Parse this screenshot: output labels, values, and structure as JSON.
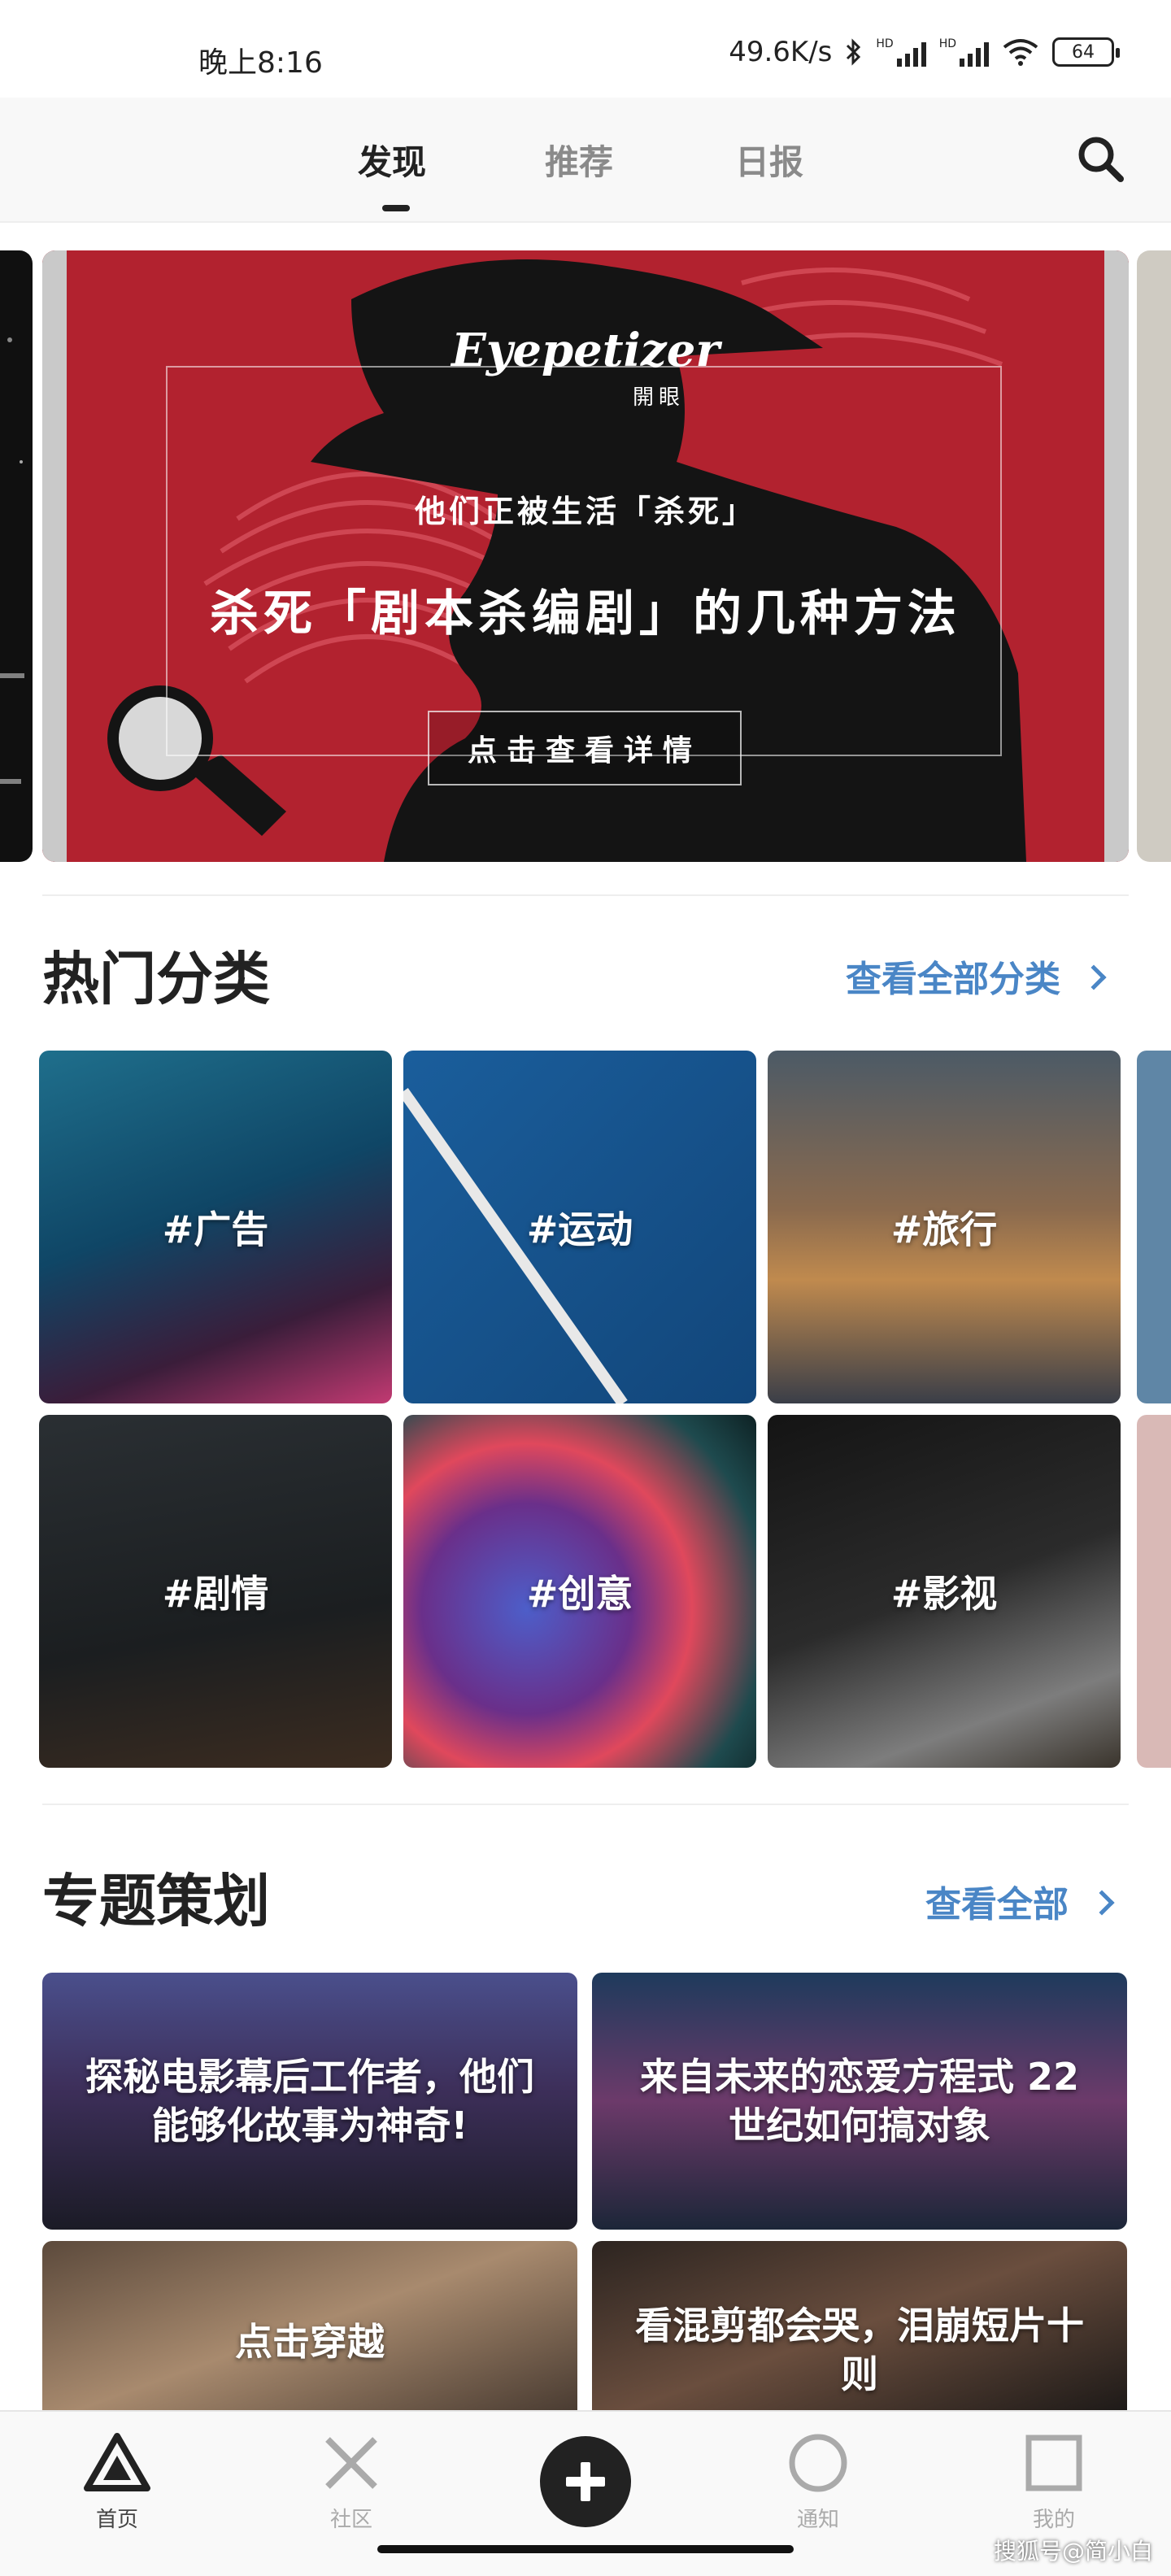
{
  "status_bar": {
    "time": "晚上8:16",
    "network_speed": "49.6K/s",
    "signal_badge_1": "HD",
    "signal_badge_2": "HD",
    "battery": "64"
  },
  "top_nav": {
    "tabs": [
      {
        "label": "发现",
        "active": true
      },
      {
        "label": "推荐",
        "active": false
      },
      {
        "label": "日报",
        "active": false
      }
    ],
    "search_icon": "search-icon"
  },
  "banner": {
    "logo": "Eyepetizer",
    "logo_sub": "開眼",
    "subtitle": "他们正被生活「杀死」",
    "title": "杀死「剧本杀编剧」的几种方法",
    "button": "点击查看详情"
  },
  "hot_categories": {
    "title": "热门分类",
    "link": "查看全部分类",
    "items": [
      {
        "label": "#广告"
      },
      {
        "label": "#运动"
      },
      {
        "label": "#旅行"
      },
      {
        "label": "#剧情"
      },
      {
        "label": "#创意"
      },
      {
        "label": "#影视"
      }
    ]
  },
  "topics": {
    "title": "专题策划",
    "link": "查看全部",
    "items": [
      {
        "label": "探秘电影幕后工作者，他们能够化故事为神奇!"
      },
      {
        "label": "来自未来的恋爱方程式 22世纪如何搞对象"
      },
      {
        "label": "点击穿越"
      },
      {
        "label": "看混剪都会哭，泪崩短片十则"
      }
    ]
  },
  "bottom_nav": {
    "items": [
      {
        "label": "首页",
        "icon": "triangle-icon",
        "active": true
      },
      {
        "label": "社区",
        "icon": "cross-icon",
        "active": false
      },
      {
        "label": "通知",
        "icon": "circle-icon",
        "active": false
      },
      {
        "label": "我的",
        "icon": "square-icon",
        "active": false
      }
    ],
    "add_icon": "plus-icon"
  },
  "watermark": "搜狐号@简小白",
  "colors": {
    "accent_link": "#4a86c6",
    "banner_red": "#b2222f",
    "text_dark": "#222222"
  }
}
